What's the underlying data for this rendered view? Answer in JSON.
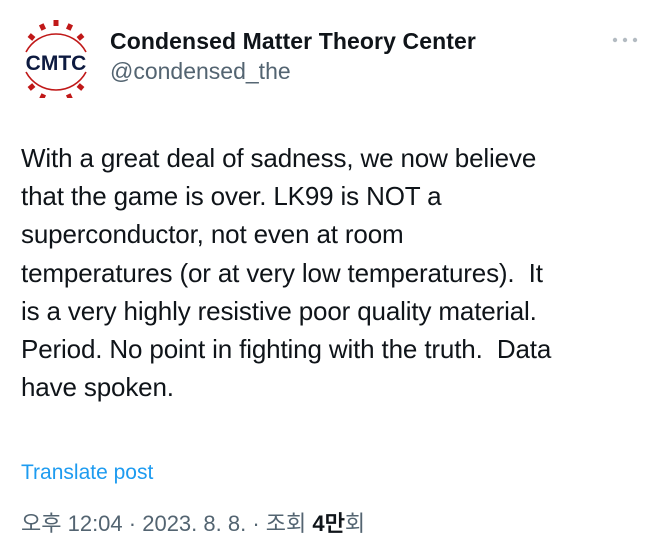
{
  "author": {
    "display_name": "Condensed Matter Theory Center",
    "handle": "@condensed_the",
    "avatar_text": "CMTC",
    "avatar_colors": {
      "text": "#0d1a40",
      "gear": "#c01818"
    }
  },
  "more_icon": "more-horizontal-icon",
  "tweet": {
    "text": "With a great deal of sadness, we now believe\nthat the game is over. LK99 is NOT a\nsuperconductor, not even at room\ntemperatures (or at very low temperatures).  It\nis a very highly resistive poor quality material.\nPeriod. No point in fighting with the truth.  Data\nhave spoken."
  },
  "translate_label": "Translate post",
  "meta": {
    "time": "오후 12:04",
    "separator1": " · ",
    "date": "2023. 8. 8.",
    "separator2": " · ",
    "views_label_prefix": "조회 ",
    "views_count": "4만",
    "views_label_suffix": "회"
  },
  "colors": {
    "link": "#1d9bf0",
    "secondary_text": "#536471",
    "primary_text": "#0f1419"
  }
}
